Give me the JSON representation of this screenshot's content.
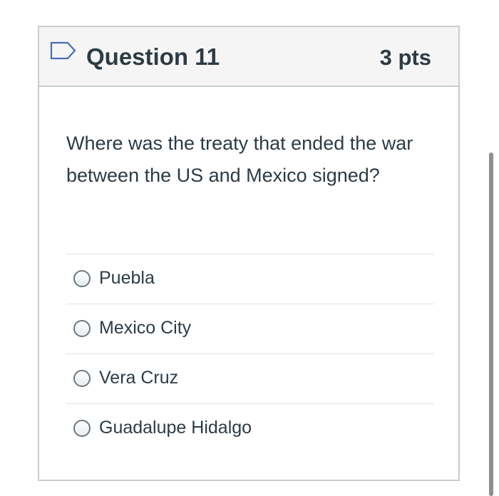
{
  "question": {
    "title": "Question 11",
    "points": "3 pts",
    "text": "Where was the treaty that ended the war between the US and Mexico signed?",
    "flag_icon": "flag-outline-icon"
  },
  "answers": [
    {
      "label": "Puebla",
      "selected": false
    },
    {
      "label": "Mexico City",
      "selected": false
    },
    {
      "label": "Vera Cruz",
      "selected": false
    },
    {
      "label": "Guadalupe Hidalgo",
      "selected": false
    }
  ],
  "colors": {
    "text": "#2d3b45",
    "header_bg": "#f5f5f5",
    "border": "#c7cdd1",
    "flag": "#4a6fb4"
  }
}
